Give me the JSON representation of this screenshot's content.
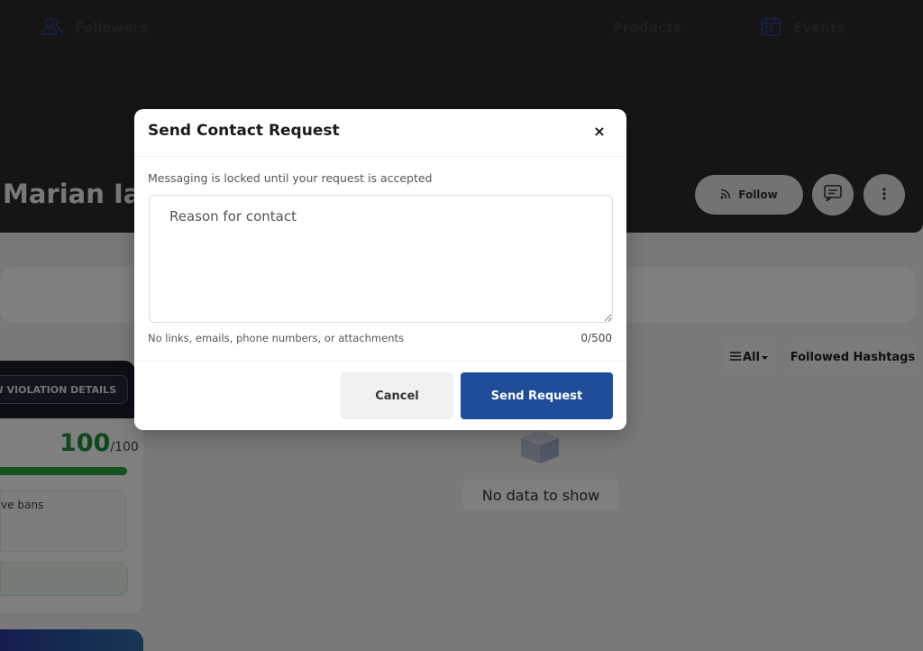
{
  "profile": {
    "name": "Marian Ian"
  },
  "actions": {
    "follow_label": "Follow"
  },
  "tabs": {
    "followers_label": "Followers",
    "products_label": "Products",
    "events_label": "Events"
  },
  "moderation": {
    "violation_button_label": "VIEW VIOLATION DETAILS",
    "score_value": "100",
    "score_max": "/100",
    "score_fraction": 1.0,
    "bans_text": "No active bans"
  },
  "feed": {
    "filter_all_label": "All",
    "filter_hashtags_label": "Followed Hashtags",
    "empty_text": "No data to show"
  },
  "modal": {
    "title": "Send Contact Request",
    "close_label": "×",
    "lock_note": "Messaging is locked until your request is accepted",
    "reason_placeholder": "Reason for contact",
    "rules_note": "No links, emails, phone numbers, or attachments",
    "char_count": "0/500",
    "cancel_label": "Cancel",
    "send_label": "Send Request"
  },
  "colors": {
    "primary": "#1f4d9a",
    "score_green": "#1e8f3a",
    "cover_dark": "#2b2b2b"
  }
}
